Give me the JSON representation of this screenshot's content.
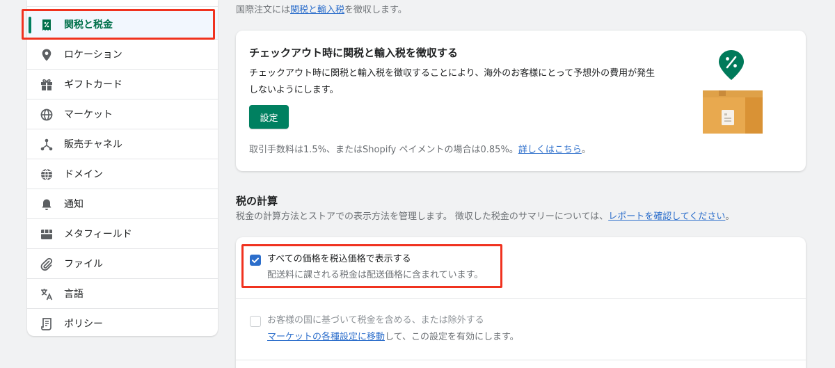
{
  "sidebar": {
    "items": [
      {
        "label": "関税と税金",
        "icon": "receipt-percent-icon",
        "active": true
      },
      {
        "label": "ロケーション",
        "icon": "location-pin-icon"
      },
      {
        "label": "ギフトカード",
        "icon": "gift-icon"
      },
      {
        "label": "マーケット",
        "icon": "globe-icon"
      },
      {
        "label": "販売チャネル",
        "icon": "channels-icon"
      },
      {
        "label": "ドメイン",
        "icon": "domain-globe-icon"
      },
      {
        "label": "通知",
        "icon": "bell-icon"
      },
      {
        "label": "メタフィールド",
        "icon": "metafields-icon"
      },
      {
        "label": "ファイル",
        "icon": "paperclip-icon"
      },
      {
        "label": "言語",
        "icon": "translate-icon"
      },
      {
        "label": "ポリシー",
        "icon": "policy-scroll-icon"
      }
    ]
  },
  "intro": {
    "prefix": "国際注文には",
    "link": "関税と輸入税",
    "suffix": "を徴収します。"
  },
  "duties_card": {
    "title": "チェックアウト時に関税と輸入税を徴収する",
    "description": "チェックアウト時に関税と輸入税を徴収することにより、海外のお客様にとって予想外の費用が発生しないようにします。",
    "button": "設定",
    "fee_prefix": "取引手数料は1.5%、またはShopify ペイメントの場合は0.85%。",
    "fee_link": "詳しくはこちら",
    "fee_suffix": "。"
  },
  "tax_section": {
    "title": "税の計算",
    "desc_prefix": "税金の計算方法とストアでの表示方法を管理します。 徴収した税金のサマリーについては、",
    "desc_link": "レポートを確認してください",
    "desc_suffix": "。"
  },
  "options": [
    {
      "label": "すべての価格を税込価格で表示する",
      "help": "配送料に課される税金は配送価格に含まれています。",
      "checked": true
    },
    {
      "label": "お客様の国に基づいて税金を含める、または除外する",
      "help_link": "マーケットの各種設定に移動",
      "help_suffix": "して、この設定を有効にします。",
      "checked": false,
      "disabled": true
    }
  ],
  "colors": {
    "accent": "#008060",
    "link": "#2c6ecb",
    "highlight": "#f0321f"
  }
}
